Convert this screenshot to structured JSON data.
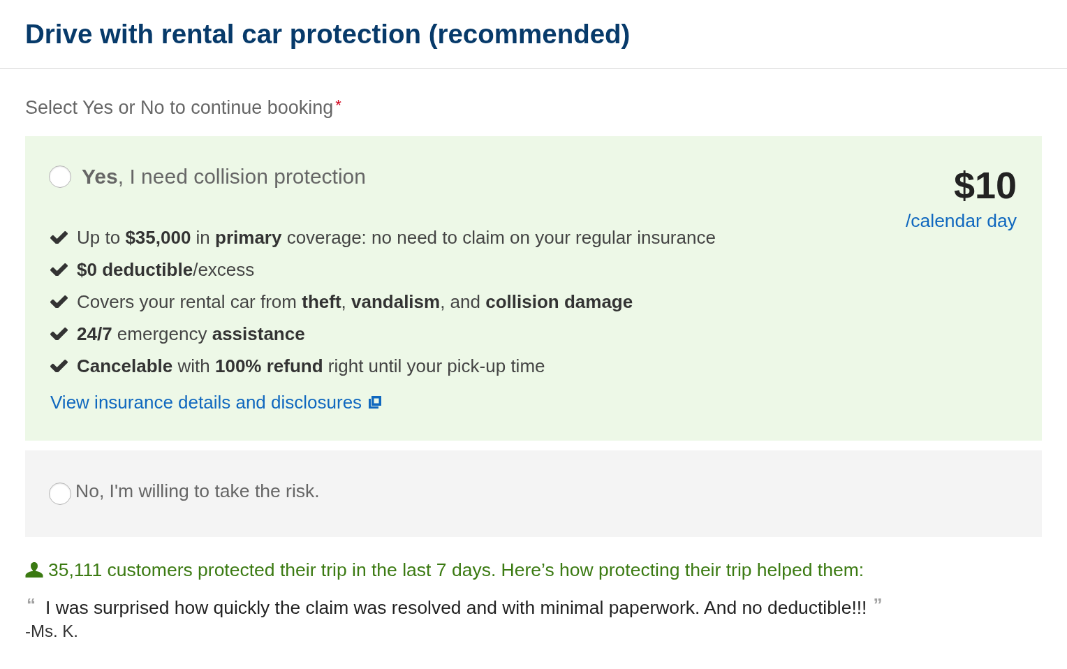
{
  "header": {
    "title": "Drive with rental car protection (recommended)"
  },
  "prompt": {
    "label": "Select Yes or No to continue booking",
    "required_mark": "*"
  },
  "options": [
    {
      "kind": "protection",
      "selected": false,
      "label": "**Yes**, I need collision protection",
      "price": "$10",
      "price_unit": "/calendar day",
      "benefits": [
        "Up to **$35,000** in **primary** coverage: no need to claim on your regular insurance",
        "**$0 deductible**/excess",
        "Covers your rental car from **theft**, **vandalism**, and **collision damage**",
        "**24/7** emergency **assistance**",
        "**Cancelable** with **100% refund** right until your pick-up time"
      ],
      "link": "View insurance details and disclosures"
    },
    {
      "kind": "decline",
      "selected": false,
      "label": "No, I'm willing to take the risk."
    }
  ],
  "social_proof": {
    "text": "35,111 customers protected their trip in the last 7 days. Here’s how protecting their trip helped them:",
    "quote": {
      "open_mark": "“",
      "text": "I was surprised how quickly the claim was resolved and with minimal paperwork. And no deductible!!!",
      "close_mark": "”",
      "author": "-Ms. K."
    }
  }
}
